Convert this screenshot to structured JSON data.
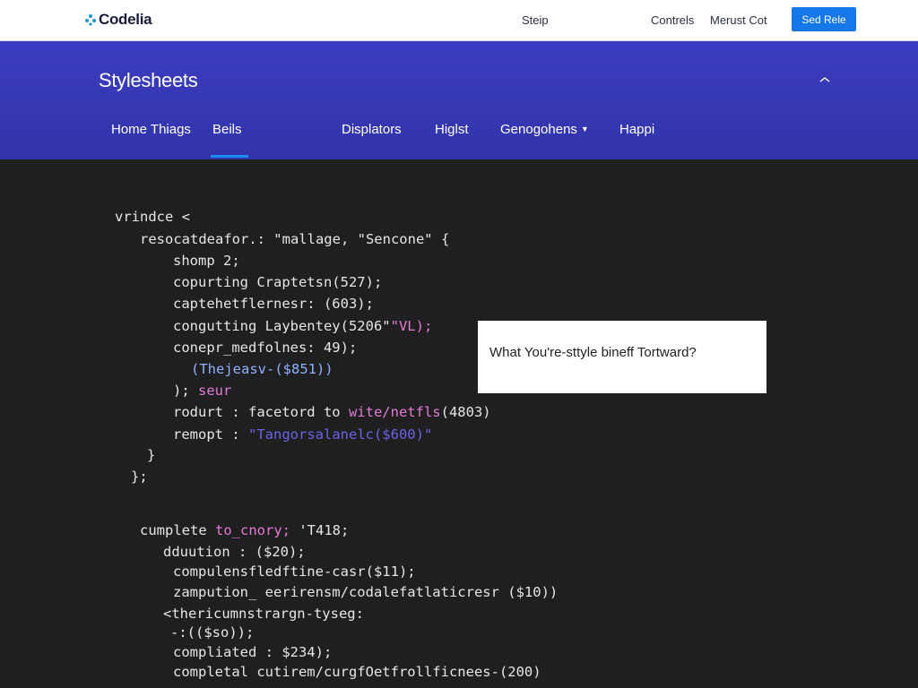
{
  "topbar": {
    "logo": "Codelia",
    "nav_center": "Steip",
    "nav_links": [
      "Contrels",
      "Merust Cot"
    ],
    "cta_label": "Sed Rele",
    "cta_color": "#1577e8"
  },
  "header": {
    "title": "Stylesheets",
    "collapse_icon": "chevron-up-icon",
    "tabs": [
      {
        "label": "Home Thiags"
      },
      {
        "label": "Beils",
        "active": true
      },
      {
        "label": "Displators"
      },
      {
        "label": "Higlst"
      },
      {
        "label": "Genogohens",
        "has_dropdown": true
      },
      {
        "label": "Happi"
      }
    ],
    "background": "#3336b4"
  },
  "code": {
    "lines": [
      {
        "text": "vrindce <"
      },
      {
        "text": "resocatdeafor.: \"mallage, \"Sencone\" {"
      },
      {
        "text": "shomp 2;"
      },
      {
        "text": "copurting Craptetsn(527);"
      },
      {
        "text": "captehetflernesr: (603);"
      },
      {
        "text": "congutting Laybentey(5206\"",
        "accent": "\"VL);"
      },
      {
        "text": "conepr_medfolnes: 49);"
      },
      {
        "text": "(Thejeasv-($851))"
      },
      {
        "text": "); ",
        "accent": "seur"
      },
      {
        "text": "rodurt : facetord to ",
        "accent": "wite/netfls",
        "tail": "(4803)"
      },
      {
        "text": "remopt : ",
        "accent": "\"Tangorsalanelc($600)\""
      },
      {
        "text": "}"
      },
      {
        "text": "};"
      },
      {
        "text": "cumplete ",
        "accent": "to_cnory;",
        "tail": " 'T418;"
      },
      {
        "text": "dduution : ($20);"
      },
      {
        "text": "compulensfledftine-casr($11);"
      },
      {
        "text": "zampution_ eerirensm/codalefatlaticresr ($10))"
      },
      {
        "text": "<thericumnstrargn-tyseg:"
      },
      {
        "text": "-:(($so));"
      },
      {
        "text": "compliated : $234);"
      },
      {
        "text": "completal cutirem/curgfOetfrollficnees-(200)"
      }
    ]
  },
  "popup": {
    "text": "What You're-sttyle bineff Tortward?"
  }
}
